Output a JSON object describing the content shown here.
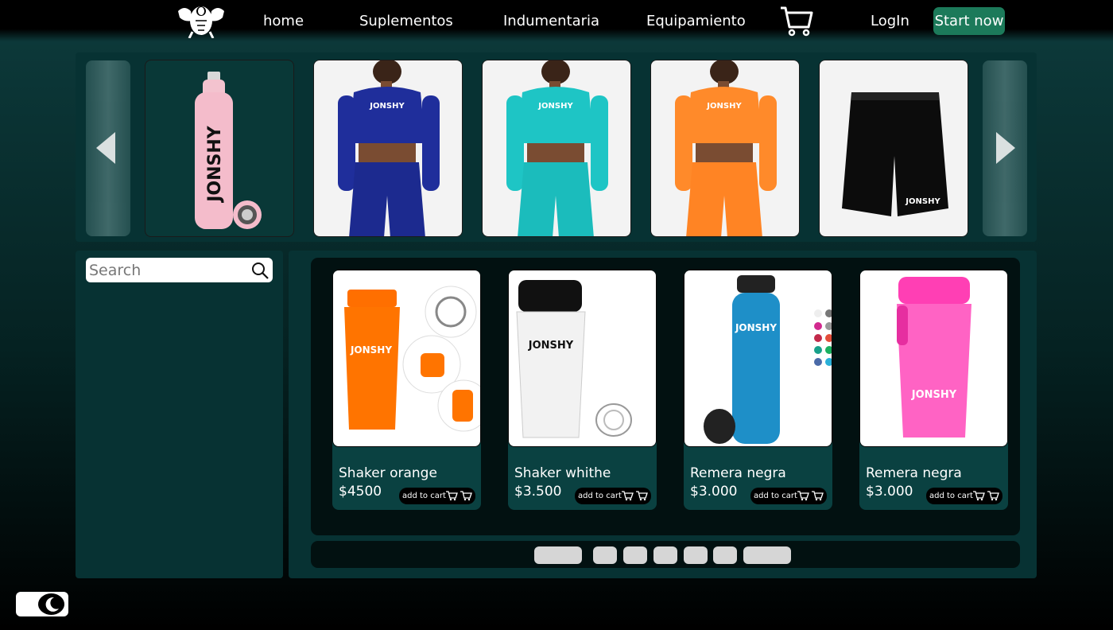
{
  "nav": {
    "logo_alt": "gym logo",
    "links": [
      "home",
      "Suplementos",
      "Indumentaria",
      "Equipamiento"
    ],
    "login": "LogIn",
    "cta": "Start now"
  },
  "carousel": {
    "items": [
      {
        "name": "pink-bottle",
        "icon": "bottle-image"
      },
      {
        "name": "blue-set",
        "icon": "outfit-image"
      },
      {
        "name": "turquoise-set",
        "icon": "outfit-image"
      },
      {
        "name": "orange-set",
        "icon": "outfit-image"
      },
      {
        "name": "black-shorts",
        "icon": "shorts-image"
      }
    ]
  },
  "search": {
    "placeholder": "Search",
    "value": ""
  },
  "products": [
    {
      "name": "Shaker orange",
      "price": "$4500",
      "action": "add to cart"
    },
    {
      "name": "Shaker whithe",
      "price": "$3.500",
      "action": "add to cart"
    },
    {
      "name": "Remera negra",
      "price": "$3.000",
      "action": "add to cart"
    },
    {
      "name": "Remera negra",
      "price": "$3.000",
      "action": "add to cart"
    }
  ],
  "colors": {
    "accent": "#1c7a5a",
    "panel": "#073233",
    "card": "#0a4141",
    "dark": "#021111"
  }
}
